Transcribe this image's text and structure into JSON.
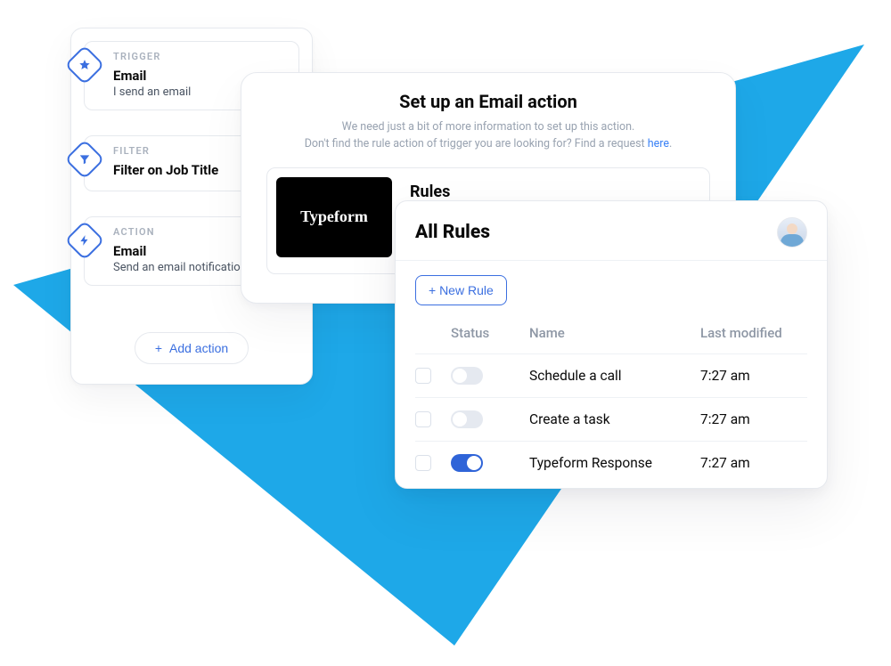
{
  "workflow": {
    "steps": [
      {
        "kind": "TRIGGER",
        "title": "Email",
        "desc": "I send an email",
        "icon": "star"
      },
      {
        "kind": "FILTER",
        "title": "Filter on Job Title",
        "desc": "",
        "icon": "funnel"
      },
      {
        "kind": "ACTION",
        "title": "Email",
        "desc": "Send an email notification",
        "icon": "bolt"
      }
    ],
    "add_action_label": "Add action"
  },
  "setup": {
    "title": "Set up an Email action",
    "subtitle_line1": "We need just a bit of more information to set up this action.",
    "subtitle_line2_prefix": "Don't find the rule action of trigger you are looking for? Find a request ",
    "subtitle_link": "here",
    "integration_name": "Typeform",
    "section_label": "Rules"
  },
  "rules": {
    "title": "All Rules",
    "new_rule_label": "+ New Rule",
    "columns": {
      "status": "Status",
      "name": "Name",
      "modified": "Last modified"
    },
    "rows": [
      {
        "name": "Schedule a call",
        "modified": "7:27 am",
        "active": false
      },
      {
        "name": "Create a task",
        "modified": "7:27 am",
        "active": false
      },
      {
        "name": "Typeform Response",
        "modified": "7:27 am",
        "active": true
      }
    ]
  }
}
